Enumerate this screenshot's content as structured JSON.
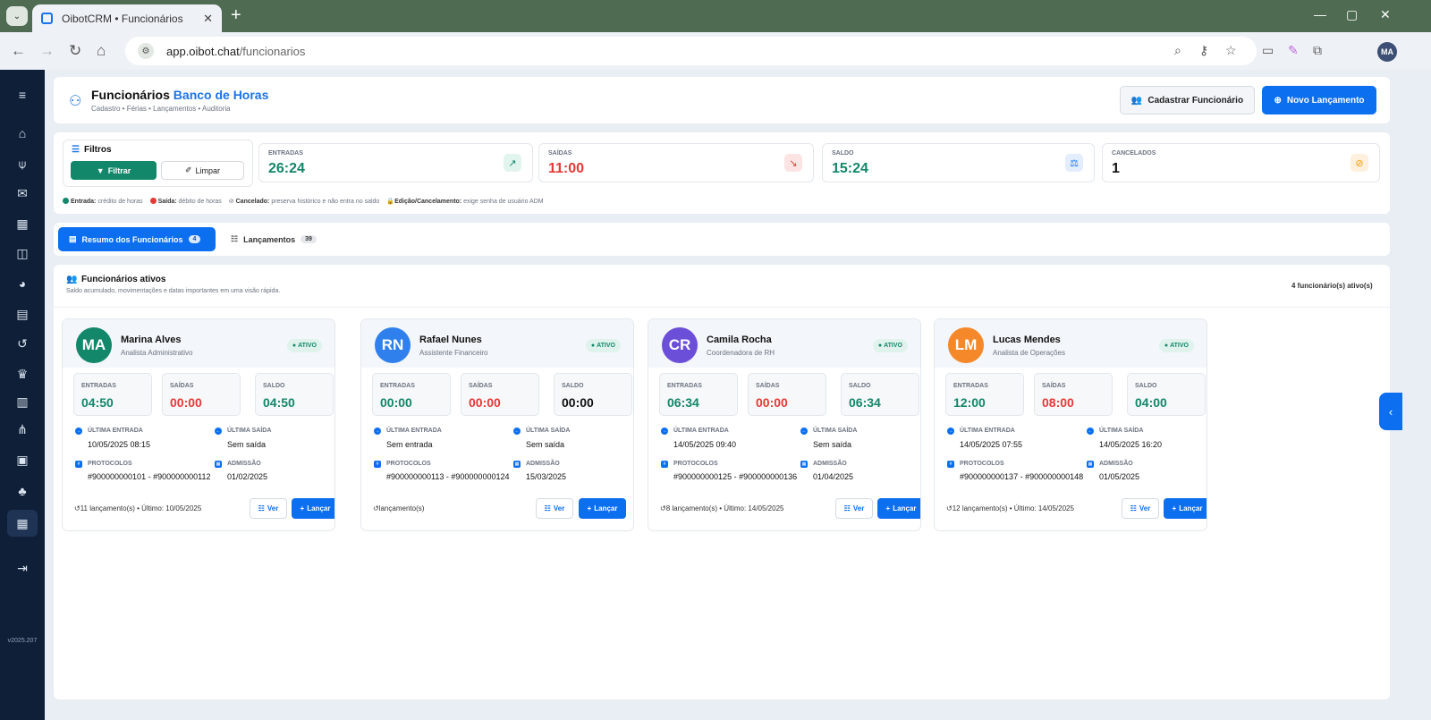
{
  "browser": {
    "tab_title": "OibotCRM • Funcionários",
    "url_host": "app.oibot.chat",
    "url_path": "/funcionarios",
    "profile": "MA"
  },
  "sidebar": {
    "version": "v2025.207"
  },
  "header": {
    "title": "Funcionários",
    "title_accent": "Banco de Horas",
    "subtitle": "Cadastro • Férias • Lançamentos • Auditoria",
    "btn_cadastrar": "Cadastrar Funcionário",
    "btn_novo": "Novo Lançamento"
  },
  "filters": {
    "label": "Filtros",
    "btn_filtrar": "Filtrar",
    "btn_limpar": "Limpar"
  },
  "stats": [
    {
      "label": "ENTRADAS",
      "value": "26:24",
      "color": "#12876a"
    },
    {
      "label": "SAÍDAS",
      "value": "11:00",
      "color": "#e53935"
    },
    {
      "label": "SALDO",
      "value": "15:24",
      "color": "#12876a"
    },
    {
      "label": "CANCELADOS",
      "value": "1",
      "color": "#111111"
    }
  ],
  "legend": [
    {
      "term": "Entrada:",
      "text": "crédito de horas"
    },
    {
      "term": "Saída:",
      "text": "débito de horas"
    },
    {
      "term": "Cancelado:",
      "text": "preserva histórico e não entra no saldo"
    },
    {
      "term": "Edição/Cancelamento:",
      "text": "exige senha de usuário ADM"
    }
  ],
  "tabs": [
    {
      "label": "Resumo dos Funcionários",
      "count": "4"
    },
    {
      "label": "Lançamentos",
      "count": "39"
    }
  ],
  "section": {
    "title": "Funcionários ativos",
    "subtitle": "Saldo acumulado, movimentações e datas importantes em uma visão rápida.",
    "count": "4 funcionário(s) ativo(s)"
  },
  "labels": {
    "entradas": "ENTRADAS",
    "saidas": "SAÍDAS",
    "saldo": "SALDO",
    "ultima_entrada": "ÚLTIMA ENTRADA",
    "ultima_saida": "ÚLTIMA SAÍDA",
    "protocolos": "PROTOCOLOS",
    "admissao": "ADMISSÃO",
    "ver": "Ver",
    "lancar": "Lançar",
    "ativo": "ATIVO"
  },
  "employees": [
    {
      "initials": "MA",
      "avatar_color": "#12876a",
      "name": "Marina Alves",
      "role": "Analista Administrativo",
      "entradas": "04:50",
      "saidas": "00:00",
      "saldo": "04:50",
      "ultima_entrada": "10/05/2025 08:15",
      "ultima_saida": "Sem saída",
      "protocolos": "#900000000101 - #900000000112",
      "admissao": "01/02/2025",
      "footer": "11 lançamento(s) • Último: 10/05/2025"
    },
    {
      "initials": "RN",
      "avatar_color": "#2f80ed",
      "name": "Rafael Nunes",
      "role": "Assistente Financeiro",
      "entradas": "00:00",
      "saidas": "00:00",
      "saldo": "00:00",
      "ultima_entrada": "Sem entrada",
      "ultima_saida": "Sem saída",
      "protocolos": "#900000000113 - #900000000124",
      "admissao": "15/03/2025",
      "footer": "lançamento(s)"
    },
    {
      "initials": "CR",
      "avatar_color": "#6c4fd8",
      "name": "Camila Rocha",
      "role": "Coordenadora de RH",
      "entradas": "06:34",
      "saidas": "00:00",
      "saldo": "06:34",
      "ultima_entrada": "14/05/2025 09:40",
      "ultima_saida": "Sem saída",
      "protocolos": "#900000000125 - #900000000136",
      "admissao": "01/04/2025",
      "footer": "8 lançamento(s) • Último: 14/05/2025"
    },
    {
      "initials": "LM",
      "avatar_color": "#f5892a",
      "name": "Lucas Mendes",
      "role": "Analista de Operações",
      "entradas": "12:00",
      "saidas": "08:00",
      "saldo": "04:00",
      "ultima_entrada": "14/05/2025 07:55",
      "ultima_saida": "14/05/2025 16:20",
      "protocolos": "#900000000137 - #900000000148",
      "admissao": "01/05/2025",
      "footer": "12 lançamento(s) • Último: 14/05/2025"
    }
  ]
}
